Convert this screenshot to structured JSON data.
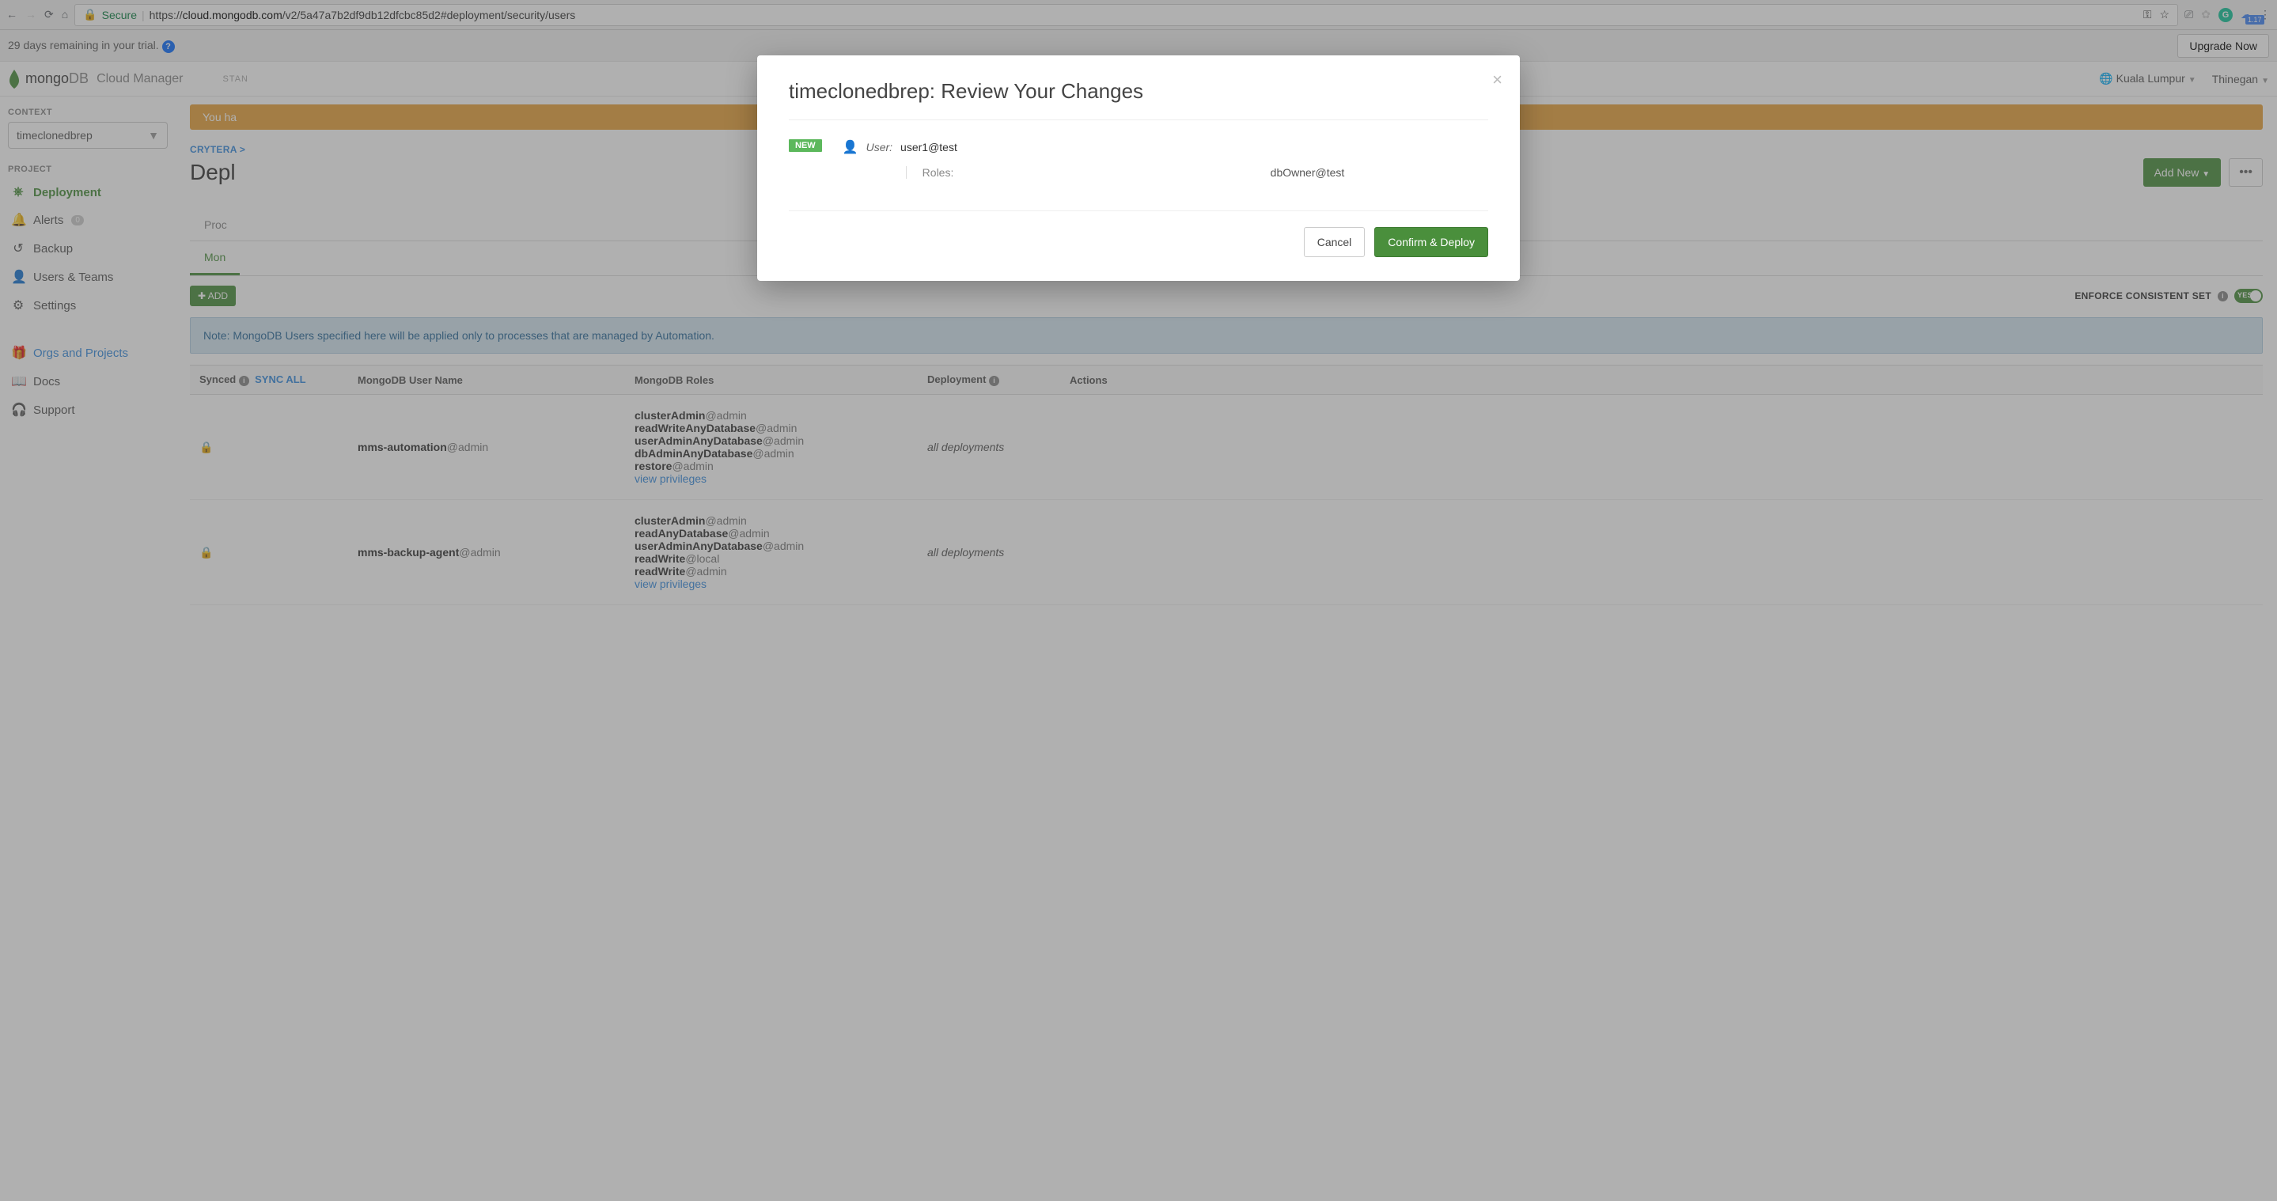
{
  "browser": {
    "url_prefix": "https://",
    "url_domain": "cloud.mongodb.com",
    "url_path": "/v2/5a47a7b2df9db12dfcbc85d2#deployment/security/users",
    "secure_label": "Secure",
    "version": "1.17"
  },
  "trial": {
    "text": "29 days remaining in your trial.",
    "upgrade": "Upgrade Now"
  },
  "header": {
    "logo_mongo": "mongo",
    "logo_db": "DB",
    "cloud_manager": "Cloud Manager",
    "plan": "STAN",
    "org": "Kuala Lumpur",
    "user": "Thinegan"
  },
  "sidebar": {
    "context_label": "CONTEXT",
    "context_value": "timeclonedbrep",
    "project_label": "PROJECT",
    "items": [
      {
        "icon": "⎈",
        "label": "Deployment",
        "active": true
      },
      {
        "icon": "🔔",
        "label": "Alerts",
        "badge": "0"
      },
      {
        "icon": "↺",
        "label": "Backup"
      },
      {
        "icon": "👤",
        "label": "Users & Teams"
      },
      {
        "icon": "⚙",
        "label": "Settings"
      }
    ],
    "global": [
      {
        "icon": "🎁",
        "label": "Orgs and Projects",
        "link": true
      },
      {
        "icon": "📖",
        "label": "Docs"
      },
      {
        "icon": "🎧",
        "label": "Support"
      }
    ]
  },
  "content": {
    "yellow_banner_prefix": "You ha",
    "breadcrumb": "CRYTERA >",
    "page_title_prefix": "Depl",
    "add_new": "Add New",
    "tabs": {
      "first": "Proc"
    },
    "subtabs": {
      "active": "Mon"
    },
    "add_btn": "ADD",
    "enforce_label": "ENFORCE CONSISTENT SET",
    "enforce_toggle": "YES",
    "note": "Note: MongoDB Users specified here will be applied only to processes that are managed by Automation.",
    "columns": {
      "synced": "Synced",
      "sync_all": "SYNC ALL",
      "username": "MongoDB User Name",
      "roles": "MongoDB Roles",
      "deployment": "Deployment",
      "actions": "Actions"
    },
    "rows": [
      {
        "username": "mms-automation",
        "userdb": "@admin",
        "roles": [
          {
            "name": "clusterAdmin",
            "db": "@admin"
          },
          {
            "name": "readWriteAnyDatabase",
            "db": "@admin"
          },
          {
            "name": "userAdminAnyDatabase",
            "db": "@admin"
          },
          {
            "name": "dbAdminAnyDatabase",
            "db": "@admin"
          },
          {
            "name": "restore",
            "db": "@admin"
          }
        ],
        "view_priv": "view privileges",
        "deployment": "all deployments"
      },
      {
        "username": "mms-backup-agent",
        "userdb": "@admin",
        "roles": [
          {
            "name": "clusterAdmin",
            "db": "@admin"
          },
          {
            "name": "readAnyDatabase",
            "db": "@admin"
          },
          {
            "name": "userAdminAnyDatabase",
            "db": "@admin"
          },
          {
            "name": "readWrite",
            "db": "@local"
          },
          {
            "name": "readWrite",
            "db": "@admin"
          }
        ],
        "view_priv": "view privileges",
        "deployment": "all deployments"
      }
    ]
  },
  "modal": {
    "title": "timeclonedbrep: Review Your Changes",
    "new_badge": "NEW",
    "user_label": "User:",
    "user_name": "user1@test",
    "roles_label": "Roles:",
    "roles_value": "dbOwner@test",
    "cancel": "Cancel",
    "confirm": "Confirm & Deploy"
  }
}
